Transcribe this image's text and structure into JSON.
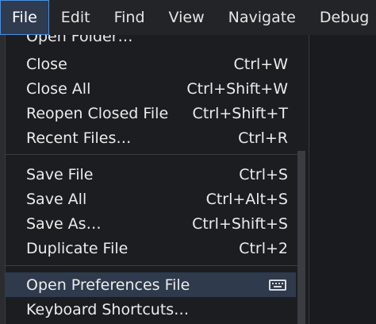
{
  "menubar": {
    "items": [
      {
        "label": "File",
        "active": true
      },
      {
        "label": "Edit"
      },
      {
        "label": "Find"
      },
      {
        "label": "View"
      },
      {
        "label": "Navigate"
      },
      {
        "label": "Debug"
      }
    ]
  },
  "file_menu": {
    "partial_top_label": "Open Folder…",
    "groups": [
      [
        {
          "label": "Close",
          "shortcut": "Ctrl+W"
        },
        {
          "label": "Close All",
          "shortcut": "Ctrl+Shift+W"
        },
        {
          "label": "Reopen Closed File",
          "shortcut": "Ctrl+Shift+T"
        },
        {
          "label": "Recent Files…",
          "shortcut": "Ctrl+R"
        }
      ],
      [
        {
          "label": "Save File",
          "shortcut": "Ctrl+S"
        },
        {
          "label": "Save All",
          "shortcut": "Ctrl+Alt+S"
        },
        {
          "label": "Save As…",
          "shortcut": "Ctrl+Shift+S"
        },
        {
          "label": "Duplicate File",
          "shortcut": "Ctrl+2"
        }
      ],
      [
        {
          "label": "Open Preferences File",
          "shortcut_icon": "keyboard-icon",
          "highlighted": true
        },
        {
          "label": "Keyboard Shortcuts…",
          "shortcut": ""
        }
      ]
    ]
  },
  "colors": {
    "accent_border": "#4a90e2",
    "highlight_bg": "#2f3a4c",
    "menu_bg": "#1c1d20"
  }
}
